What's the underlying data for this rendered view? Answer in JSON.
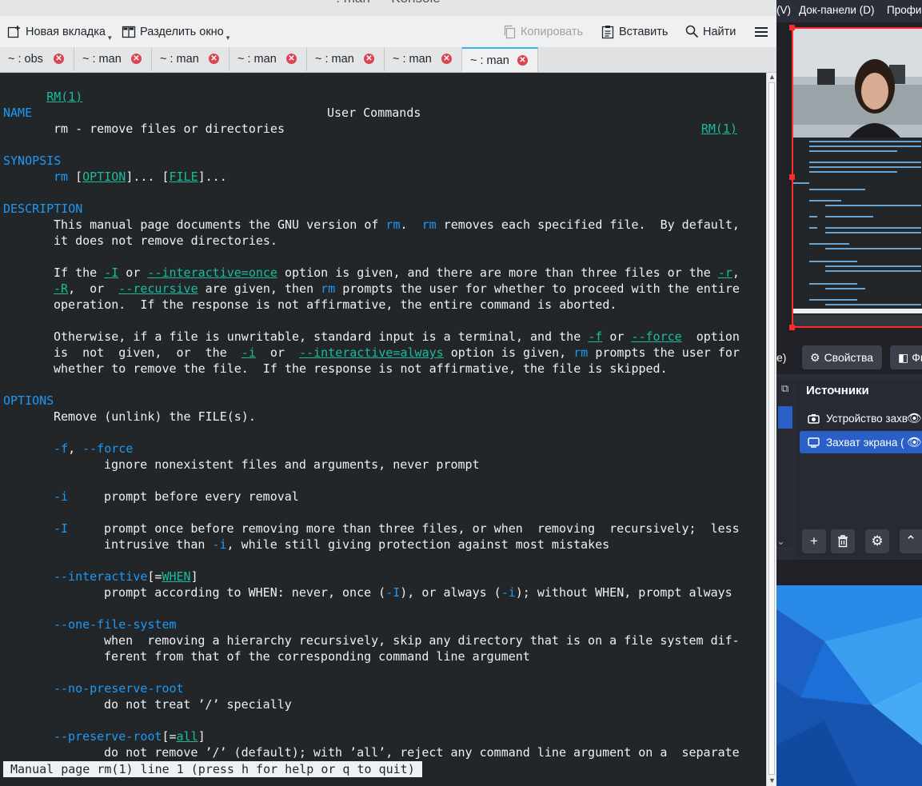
{
  "window": {
    "title": ": man — Konsole"
  },
  "toolbar": {
    "new_tab": "Новая вкладка",
    "split": "Разделить окно",
    "copy": "Копировать",
    "paste": "Вставить",
    "find": "Найти"
  },
  "tabs": [
    {
      "label": "~ : obs"
    },
    {
      "label": "~ : man"
    },
    {
      "label": "~ : man"
    },
    {
      "label": "~ : man"
    },
    {
      "label": "~ : man"
    },
    {
      "label": "~ : man"
    },
    {
      "label": "~ : man",
      "active": true
    }
  ],
  "man": {
    "header_left": "RM(1)",
    "header_center": "User Commands",
    "header_right": "RM(1)",
    "name_heading": "NAME",
    "name_text": "rm - remove files or directories",
    "synopsis_heading": "SYNOPSIS",
    "desc_heading": "DESCRIPTION",
    "desc_p1": [
      "This manual page documents the GNU version of rm.  rm removes each specified file.  By default,",
      "it does not remove directories."
    ],
    "desc_p2": [
      "If the -I or --interactive=once option is given, and there are more than three files or the -r,",
      "-R,  or  --recursive are given, then rm prompts the user for whether to proceed with the entire",
      "operation.  If the response is not affirmative, the entire command is aborted."
    ],
    "desc_p3": [
      "Otherwise, if a file is unwritable, standard input is a terminal, and the -f or --force  option",
      "is  not  given,  or  the  -i  or  --interactive=always option is given, rm prompts the user for",
      "whether to remove the file.  If the response is not affirmative, the file is skipped."
    ],
    "options_heading": "OPTIONS",
    "options_intro": "Remove (unlink) the FILE(s).",
    "opt_f": "-f, --force",
    "opt_f_desc": "ignore nonexistent files and arguments, never prompt",
    "opt_i": "-i",
    "opt_i_desc": "prompt before every removal",
    "opt_I": "-I",
    "opt_I_desc": [
      "prompt once before removing more than three files, or when  removing  recursively;  less",
      "intrusive than -i, while still giving protection against most mistakes"
    ],
    "opt_interactive": "--interactive[=WHEN]",
    "opt_interactive_desc": "prompt according to WHEN: never, once (-I), or always (-i); without WHEN, prompt always",
    "opt_one_fs": "--one-file-system",
    "opt_one_fs_desc": [
      "when  removing a hierarchy recursively, skip any directory that is on a file system dif-",
      "ferent from that of the corresponding command line argument"
    ],
    "opt_no_preserve": "--no-preserve-root",
    "opt_no_preserve_desc": "do not treat ’/’ specially",
    "opt_preserve": "--preserve-root[=all]",
    "opt_preserve_desc": "do not remove ’/’ (default); with ’all’, reject any command line argument on a  separate",
    "status": "Manual page rm(1) line 1 (press h for help or q to quit)"
  },
  "obs": {
    "menu_view": "(V)",
    "menu_docks": "Док-панели (D)",
    "menu_profile": "Профи",
    "properties_button": "Свойства",
    "filters_button": "Фи",
    "scene_button_tail": "e)",
    "sources_title": "Источники",
    "sources": [
      {
        "label": "Устройство захв",
        "icon": "camera-icon"
      },
      {
        "label": "Захват экрана (",
        "icon": "monitor-icon",
        "selected": true
      }
    ],
    "accent": "#2a5fc7"
  },
  "colors": {
    "heading": "#1d99f3",
    "link": "#1abc9c",
    "terminal_bg": "#232629",
    "close": "#da4453"
  }
}
